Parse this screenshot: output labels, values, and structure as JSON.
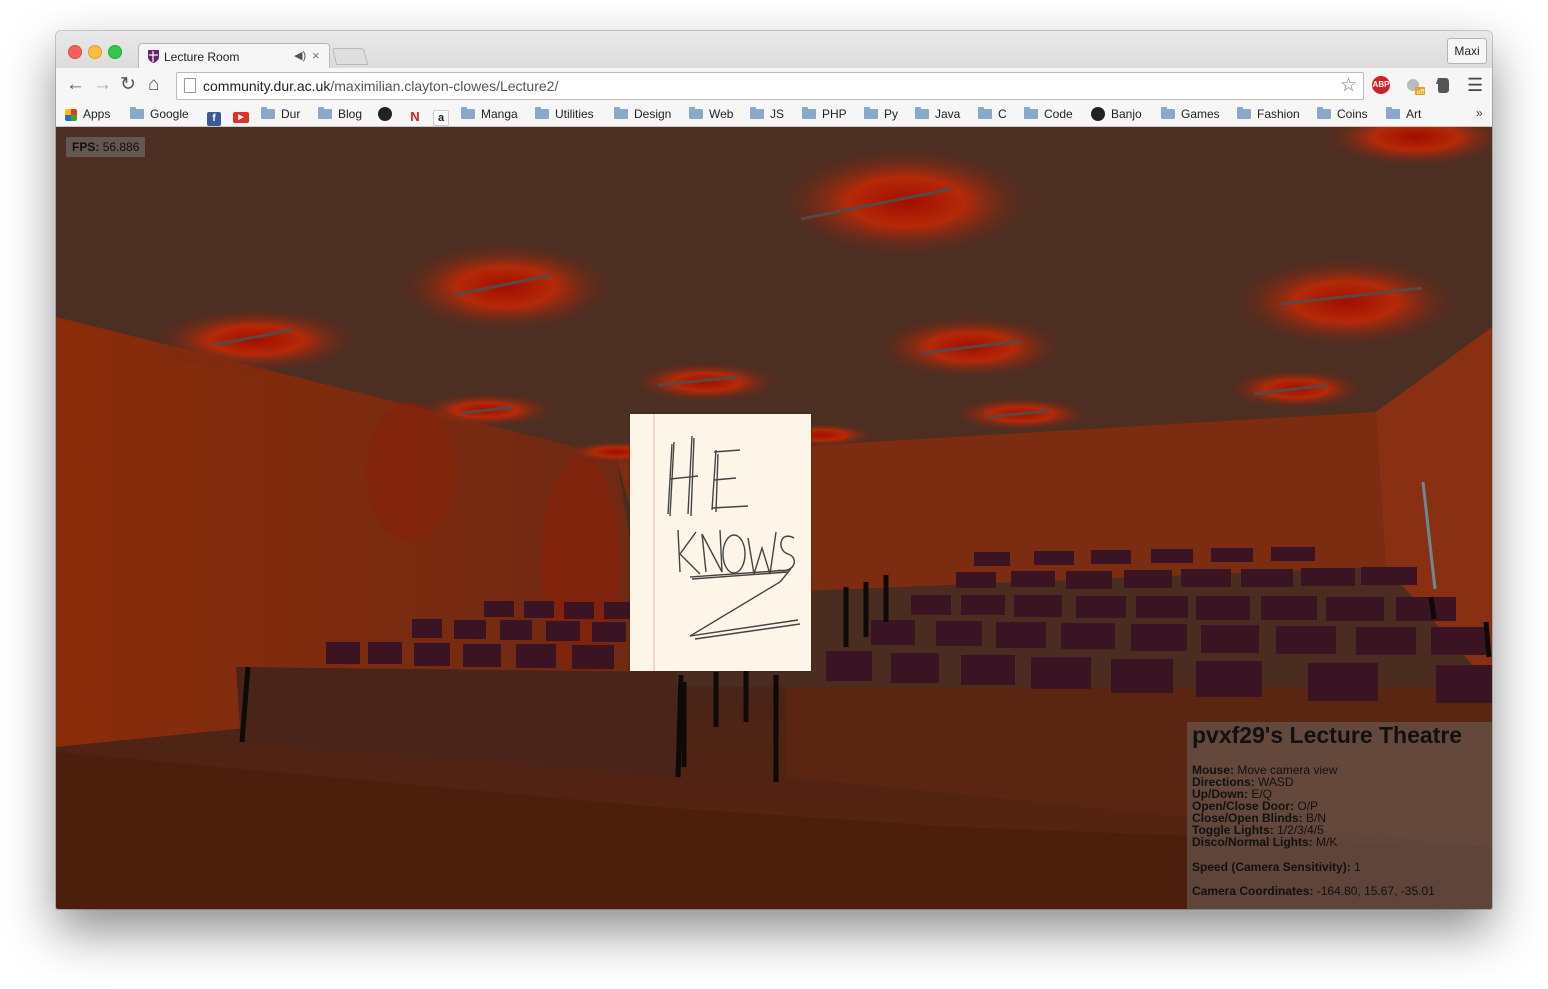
{
  "tab": {
    "title": "Lecture Room",
    "audio_icon": "speaker-icon",
    "close": "×"
  },
  "profile": {
    "name": "Maxi"
  },
  "nav": {
    "back": "←",
    "forward": "→",
    "reload": "↻",
    "home": "⌂"
  },
  "address": {
    "host": "community.dur.ac.uk",
    "path": "/maximilian.clayton-clowes/Lecture2/"
  },
  "extensions": {
    "abp": "ABP",
    "off_badge": "off"
  },
  "bookmarks": {
    "apps": "Apps",
    "google": "Google",
    "dur": "Dur",
    "blog": "Blog",
    "manga": "Manga",
    "utilities": "Utilities",
    "design": "Design",
    "web": "Web",
    "js": "JS",
    "php": "PHP",
    "py": "Py",
    "java": "Java",
    "c": "C",
    "code": "Code",
    "banjo": "Banjo",
    "games": "Games",
    "fashion": "Fashion",
    "coins": "Coins",
    "art": "Art",
    "more": "»"
  },
  "fps": {
    "label": "FPS:",
    "value": "56.886"
  },
  "note": {
    "text_line1": "HE",
    "text_line2": "KNOWS",
    "text_line3": "Z"
  },
  "info": {
    "title": "pvxf29's Lecture Theatre",
    "mouse_k": "Mouse:",
    "mouse_v": "Move camera view",
    "dir_k": "Directions:",
    "dir_v": "WASD",
    "updown_k": "Up/Down:",
    "updown_v": "E/Q",
    "door_k": "Open/Close Door:",
    "door_v": "O/P",
    "blinds_k": "Close/Open Blinds:",
    "blinds_v": "B/N",
    "lights_k": "Toggle Lights:",
    "lights_v": "1/2/3/4/5",
    "disco_k": "Disco/Normal Lights:",
    "disco_v": "M/K",
    "speed_k": "Speed (Camera Sensitivity):",
    "speed_v": "1",
    "coords_k": "Camera Coordinates:",
    "coords_v": "-164.80, 15.67, -35.01"
  },
  "colors": {
    "wall": "#7a2a0e",
    "ceiling": "#4a2a1c",
    "light": "#b01a00",
    "seat": "#3a1420"
  }
}
